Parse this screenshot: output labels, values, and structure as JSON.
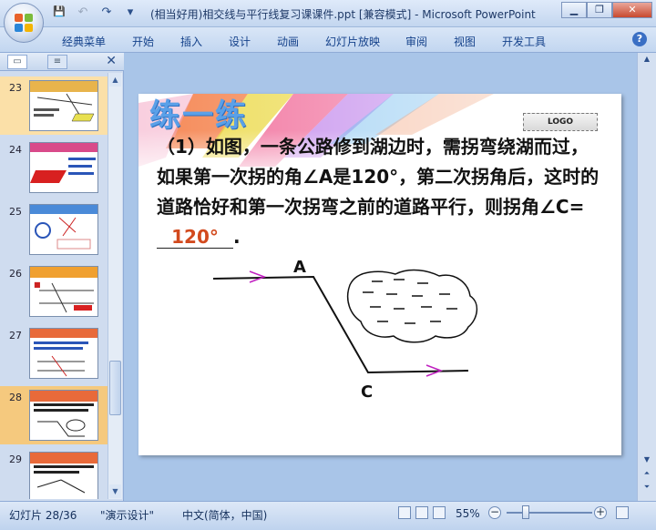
{
  "window": {
    "title": "(相当好用)相交线与平行线复习课课件.ppt [兼容模式] - Microsoft PowerPoint",
    "min": "▁",
    "max": "❐",
    "close": "✕"
  },
  "qat": {
    "save": "💾",
    "undo": "↶",
    "redo": "↷",
    "more": "▾"
  },
  "ribbon": {
    "tabs": [
      "经典菜单",
      "开始",
      "插入",
      "设计",
      "动画",
      "幻灯片放映",
      "审阅",
      "视图",
      "开发工具"
    ],
    "help": "?"
  },
  "panel": {
    "close": "✕",
    "slides": [
      {
        "num": "23"
      },
      {
        "num": "24"
      },
      {
        "num": "25"
      },
      {
        "num": "26"
      },
      {
        "num": "27"
      },
      {
        "num": "28"
      },
      {
        "num": "29"
      }
    ]
  },
  "slide": {
    "title": "练一练",
    "logo": "LOGO",
    "question_pre": "（1）如图，一条公路修到湖边时，需拐弯绕湖而过，如果第一次拐的角∠A是120°，第二次拐角后，这时的道路恰好和第一次拐弯之前的道路平行，则拐角∠C=",
    "answer": "120°",
    "question_post": ".",
    "label_a": "A",
    "label_c": "C"
  },
  "status": {
    "slide_pos": "幻灯片 28/36",
    "theme": "\"演示设计\"",
    "lang": "中文(简体，中国)",
    "zoom": "55%",
    "zoom_minus": "−",
    "zoom_plus": "+"
  },
  "colors": {
    "accent": "#15428b",
    "selected": "#f5c97e",
    "answer": "#d24a1e"
  }
}
